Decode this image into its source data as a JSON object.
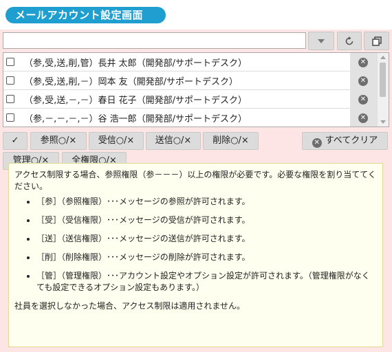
{
  "title": "メールアカウント設定画面",
  "search": {
    "value": "",
    "placeholder": ""
  },
  "toolbar": {
    "dropdown_icon": "chevron-down-icon",
    "refresh_icon": "refresh-icon",
    "window_icon": "copy-window-icon"
  },
  "rows": [
    {
      "label": "（参,受,送,削,管）長井 太郎（開発部/サポートデスク）",
      "checked": false
    },
    {
      "label": "（参,受,送,削,－）岡本 友（開発部/サポートデスク）",
      "checked": false
    },
    {
      "label": "（参,受,送,－,－）春日 花子（開発部/サポートデスク）",
      "checked": false
    },
    {
      "label": "（参,－,－,－,－）谷 浩一郎（開発部/サポートデスク）",
      "checked": false
    }
  ],
  "buttons": {
    "check": "✓",
    "view": "参照○/×",
    "receive": "受信○/×",
    "send": "送信○/×",
    "delete": "削除○/×",
    "clear_all": "すべてクリア",
    "manage": "管理○/×",
    "all": "全権限○/×"
  },
  "info": {
    "intro": "アクセス制限する場合、参照権限（参－－－）以上の権限が必要です。必要な権限を割り当ててください。",
    "items": [
      "［参］（参照権限）･･･メッセージの参照が許可されます。",
      "［受］（受信権限）･･･メッセージの受信が許可されます。",
      "［送］（送信権限）･･･メッセージの送信が許可されます。",
      "［削］（削除権限）･･･メッセージの削除が許可されます。",
      "［管］（管理権限）･･･アカウント設定やオプション設定が許可されます。（管理権限がなくても設定できるオプション設定もあります。）"
    ],
    "footer": "社員を選択しなかった場合、アクセス制限は適用されません。"
  },
  "colors": {
    "title_bg": "#1f9fd0",
    "panel_bg": "#fde5e5",
    "info_bg": "#fffff0",
    "info_border": "#e0d890",
    "button_bg": "#dcdcdc"
  }
}
